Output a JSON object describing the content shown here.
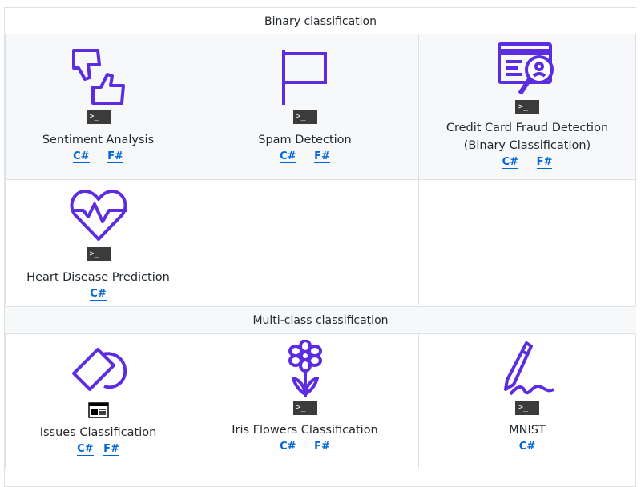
{
  "sections": {
    "binary": {
      "title": "Binary classification"
    },
    "multiclass": {
      "title": "Multi-class classification"
    }
  },
  "cells": {
    "sentiment": {
      "title": "Sentiment Analysis",
      "links": [
        "C#",
        "F#"
      ],
      "icon": "thumbs-up-down-icon",
      "app_type": "console-app-icon"
    },
    "spam": {
      "title": "Spam Detection",
      "links": [
        "C#",
        "F#"
      ],
      "icon": "flag-icon",
      "app_type": "console-app-icon"
    },
    "fraud": {
      "title_line1": "Credit Card Fraud Detection",
      "title_line2": "(Binary Classification)",
      "links": [
        "C#",
        "F#"
      ],
      "icon": "credit-card-magnifier-icon",
      "app_type": "console-app-icon"
    },
    "heart": {
      "title": "Heart Disease Prediction",
      "links": [
        "C#"
      ],
      "icon": "heart-pulse-icon",
      "app_type": "console-app-icon"
    },
    "issues": {
      "title": "Issues Classification",
      "links": [
        "C#",
        "F#"
      ],
      "icon": "tag-icon",
      "app_type": "web-app-icon"
    },
    "iris": {
      "title": "Iris Flowers Classification",
      "links": [
        "C#",
        "F#"
      ],
      "icon": "flower-icon",
      "app_type": "console-app-icon"
    },
    "mnist": {
      "title": "MNIST",
      "links": [
        "C#"
      ],
      "icon": "pen-signature-icon",
      "app_type": "console-app-icon"
    }
  },
  "badge": {
    "prompt": ">_"
  },
  "colors": {
    "icon_purple": "#5c2de0",
    "link_blue": "#0366d6",
    "border": "#dfe2e5",
    "shade": "#f6f8fa"
  }
}
